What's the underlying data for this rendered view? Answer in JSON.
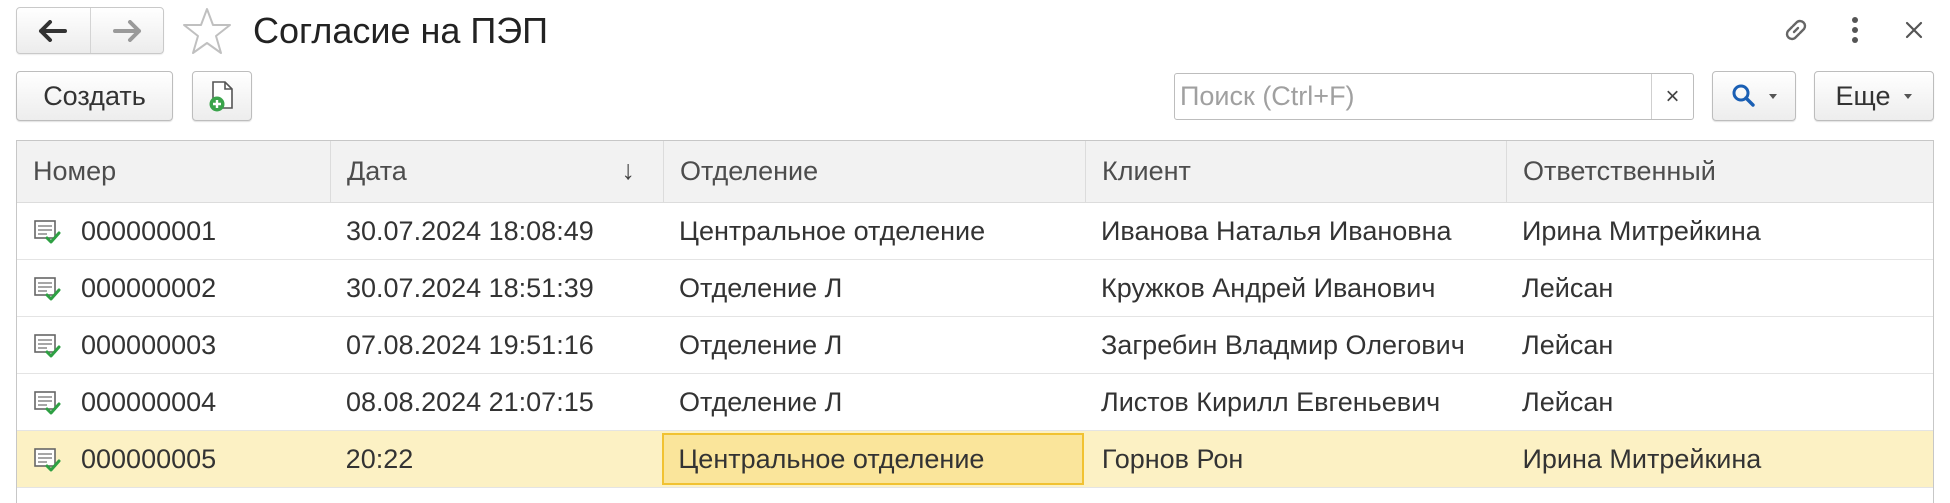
{
  "window": {
    "title": "Согласие на ПЭП",
    "nav_back_icon": "arrow-left-icon",
    "nav_forward_icon": "arrow-right-icon",
    "favorite_icon": "star-icon",
    "link_icon": "link-icon",
    "more_icon": "vertical-dots-icon",
    "close_icon": "close-icon"
  },
  "toolbar": {
    "create_label": "Создать",
    "create_copy_icon": "document-add-icon",
    "search": {
      "placeholder": "Поиск (Ctrl+F)",
      "value": "",
      "clear_label": "×"
    },
    "search_button_icon": "search-icon",
    "more_label": "Еще"
  },
  "table": {
    "columns": [
      "Номер",
      "Дата",
      "Отделение",
      "Клиент",
      "Ответственный"
    ],
    "sort": {
      "column": "Дата",
      "direction_glyph": "↓"
    },
    "rows": [
      {
        "number": "000000001",
        "date": "30.07.2024 18:08:49",
        "department": "Центральное отделение",
        "client": "Иванова Наталья Ивановна",
        "responsible": "Ирина Митрейкина"
      },
      {
        "number": "000000002",
        "date": "30.07.2024 18:51:39",
        "department": "Отделение Л",
        "client": "Кружков Андрей Иванович",
        "responsible": "Лейсан"
      },
      {
        "number": "000000003",
        "date": "07.08.2024 19:51:16",
        "department": "Отделение Л",
        "client": "Загребин Владмир Олегович",
        "responsible": "Лейсан"
      },
      {
        "number": "000000004",
        "date": "08.08.2024 21:07:15",
        "department": "Отделение Л",
        "client": "Листов Кирилл Евгеньевич",
        "responsible": "Лейсан"
      },
      {
        "number": "000000005",
        "date": "20:22",
        "department": "Центральное отделение",
        "client": "Горнов Рон",
        "responsible": "Ирина Митрейкина"
      }
    ],
    "selected_row": 4,
    "focused_column": "Отделение",
    "row_icon": "posted-document-icon"
  },
  "colors": {
    "selected_row": "#fcf1c4",
    "focused_cell": "#fae59b",
    "focused_cell_border": "#f1c232",
    "search_accent": "#1a5fb4",
    "header_bg": "#f2f2f2"
  }
}
